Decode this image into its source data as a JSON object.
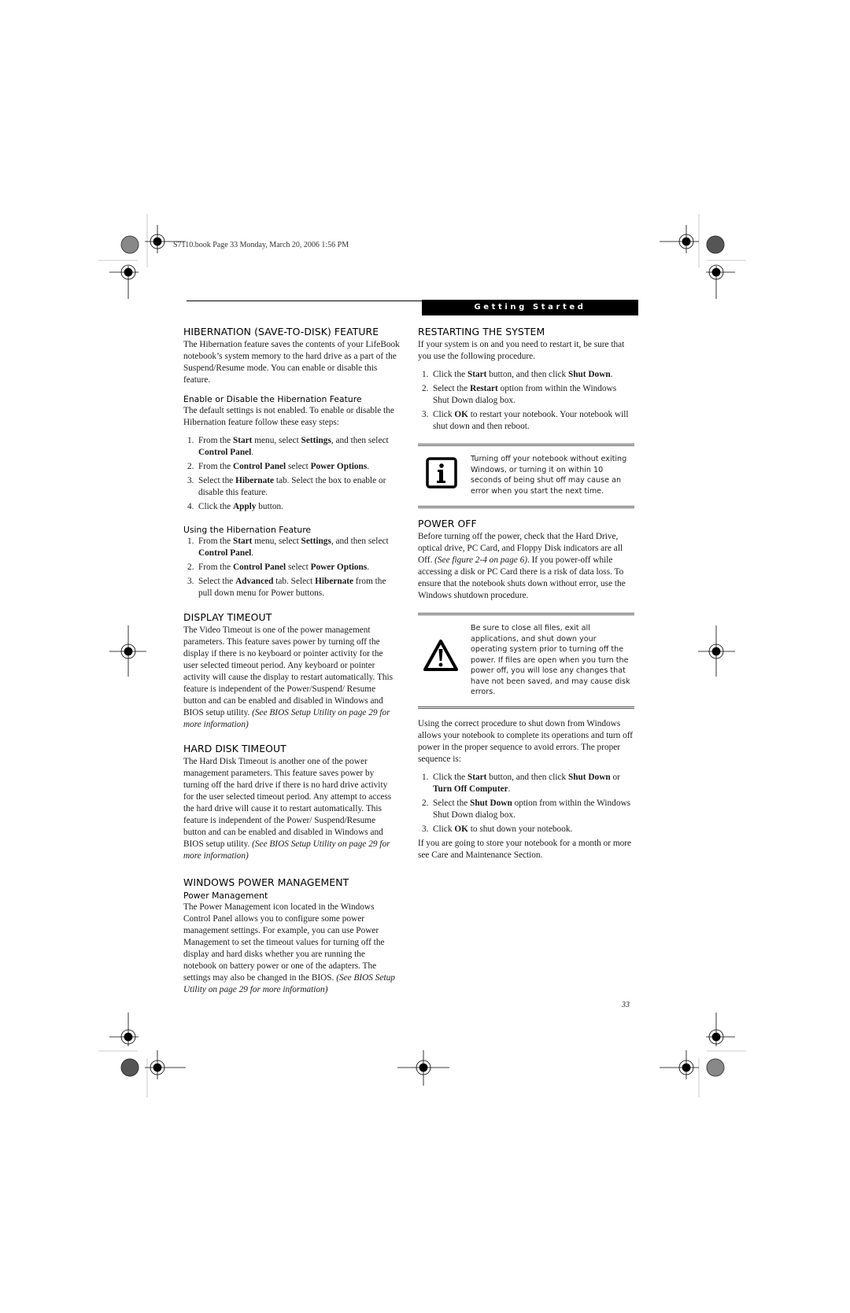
{
  "slug": "S7110.book  Page 33  Monday, March 20, 2006  1:56 PM",
  "banner": "Getting Started",
  "page_number": "33",
  "left": {
    "hibernation": {
      "title": "HIBERNATION (SAVE-TO-DISK) FEATURE",
      "intro": "The Hibernation feature saves the contents of your LifeBook notebook’s system memory to the hard drive as a part of the Suspend/Resume mode. You can enable or disable this feature.",
      "enable_title": "Enable or Disable the Hibernation Feature",
      "enable_intro": "The default settings is not enabled. To enable or disable the Hibernation feature follow these easy steps:",
      "enable_steps": [
        {
          "n": "1.",
          "parts": [
            [
              "From the ",
              ""
            ],
            [
              "Start",
              "b"
            ],
            [
              " menu, select ",
              ""
            ],
            [
              "Settings",
              "b"
            ],
            [
              ", and then select ",
              ""
            ],
            [
              "Control Panel",
              "b"
            ],
            [
              ".",
              ""
            ]
          ]
        },
        {
          "n": "2.",
          "parts": [
            [
              "From the ",
              ""
            ],
            [
              "Control Panel",
              "b"
            ],
            [
              " select ",
              ""
            ],
            [
              "Power Options",
              "b"
            ],
            [
              ".",
              ""
            ]
          ]
        },
        {
          "n": "3.",
          "parts": [
            [
              "Select the ",
              ""
            ],
            [
              "Hibernate",
              "b"
            ],
            [
              " tab. Select the box to enable or disable this feature.",
              ""
            ]
          ]
        },
        {
          "n": "4.",
          "parts": [
            [
              "Click the ",
              ""
            ],
            [
              "Apply",
              "b"
            ],
            [
              " button.",
              ""
            ]
          ]
        }
      ],
      "using_title": "Using the Hibernation Feature",
      "using_steps": [
        {
          "n": "1.",
          "parts": [
            [
              "From the ",
              ""
            ],
            [
              "Start",
              "b"
            ],
            [
              " menu, select ",
              ""
            ],
            [
              "Settings",
              "b"
            ],
            [
              ", and then select ",
              ""
            ],
            [
              "Control Panel",
              "b"
            ],
            [
              ".",
              ""
            ]
          ]
        },
        {
          "n": "2.",
          "parts": [
            [
              "From the ",
              ""
            ],
            [
              "Control Panel",
              "b"
            ],
            [
              " select ",
              ""
            ],
            [
              "Power Options",
              "b"
            ],
            [
              ".",
              ""
            ]
          ]
        },
        {
          "n": "3.",
          "parts": [
            [
              "Select the ",
              ""
            ],
            [
              "Advanced",
              "b"
            ],
            [
              " tab. Select ",
              ""
            ],
            [
              "Hibernate",
              "b"
            ],
            [
              " from the pull down menu for Power buttons.",
              ""
            ]
          ]
        }
      ]
    },
    "display_timeout": {
      "title": "DISPLAY TIMEOUT",
      "body": "The Video Timeout is one of the power management parameters. This feature saves power by turning off the display if there is no keyboard or pointer activity for the user selected timeout period. Any keyboard or pointer activity will cause the display to restart automatically. This feature is independent of the Power/Suspend/ Resume button and can be enabled and disabled in Windows and BIOS setup utility. ",
      "ref": "(See BIOS Setup Utility on page 29 for more information)"
    },
    "hard_disk_timeout": {
      "title": "HARD DISK TIMEOUT",
      "body": "The Hard Disk Timeout is another one of the power management parameters. This feature saves power by turning off the hard drive if there is no hard drive activity for the user selected timeout period. Any attempt to access the hard drive will cause it to restart automatically. This feature is independent of the Power/ Suspend/Resume button and can be enabled and disabled in Windows and BIOS setup utility. ",
      "ref": "(See BIOS Setup Utility on page 29 for more information)"
    },
    "windows_pm": {
      "title": "WINDOWS POWER MANAGEMENT",
      "subtitle": "Power Management",
      "body": "The Power Management icon located in the Windows Control Panel allows you to configure some power management settings. For example, you can use Power Management to set the timeout values for turning off the display and hard disks whether you are running the notebook on battery power or one of the adapters. The settings may also be changed in the BIOS. ",
      "ref": "(See BIOS Setup Utility on page 29 for more information)"
    }
  },
  "right": {
    "restarting": {
      "title": "RESTARTING THE SYSTEM",
      "intro": "If your system is on and you need to restart it, be sure that you use the following procedure.",
      "steps": [
        {
          "n": "1.",
          "parts": [
            [
              "Click the ",
              ""
            ],
            [
              "Start",
              "b"
            ],
            [
              " button, and then click ",
              ""
            ],
            [
              "Shut Down",
              "b"
            ],
            [
              ".",
              ""
            ]
          ]
        },
        {
          "n": "2.",
          "parts": [
            [
              "Select the ",
              ""
            ],
            [
              "Restart",
              "b"
            ],
            [
              " option from within the Windows Shut Down dialog box.",
              ""
            ]
          ]
        },
        {
          "n": "3.",
          "parts": [
            [
              "Click ",
              ""
            ],
            [
              "OK",
              "b"
            ],
            [
              " to restart your notebook. Your notebook will shut down and then reboot.",
              ""
            ]
          ]
        }
      ],
      "note_icon": "info-icon",
      "note": "Turning off your notebook without exiting Windows, or turning it on within 10 seconds of being shut off may cause an error when you start the next time."
    },
    "power_off": {
      "title": "POWER OFF",
      "intro_a": "Before turning off the power, check that the Hard Drive, optical drive, PC Card, and Floppy Disk indicators are all Off. ",
      "intro_ref": "(See figure 2-4 on page 6)",
      "intro_b": ". If you power-off while accessing a disk or PC Card there is a risk of data loss. To ensure that the notebook shuts down without error, use the Windows shutdown procedure.",
      "warning_icon": "warning-icon",
      "warning": "Be sure to close all files, exit all applications, and shut down your operating system prior to turning off the power. If files are open when you turn the power off, you will lose any changes that have not been saved, and may cause disk errors.",
      "proc_intro": "Using the correct procedure to shut down from Windows allows your notebook to complete its operations and turn off power in the proper sequence to avoid errors. The proper sequence is:",
      "steps": [
        {
          "n": "1.",
          "parts": [
            [
              "Click the ",
              ""
            ],
            [
              "Start",
              "b"
            ],
            [
              " button, and then click ",
              ""
            ],
            [
              "Shut Down",
              "b"
            ],
            [
              " or ",
              ""
            ],
            [
              "Turn Off Computer",
              "b"
            ],
            [
              ".",
              ""
            ]
          ]
        },
        {
          "n": "2.",
          "parts": [
            [
              "Select the ",
              ""
            ],
            [
              "Shut Down",
              "b"
            ],
            [
              " option from within the Windows Shut Down dialog box.",
              ""
            ]
          ]
        },
        {
          "n": "3.",
          "parts": [
            [
              "Click ",
              ""
            ],
            [
              "OK",
              "b"
            ],
            [
              " to shut down your notebook.",
              ""
            ]
          ]
        }
      ],
      "closing": "If you are going to store your notebook for a month or more see Care and Maintenance Section."
    }
  }
}
